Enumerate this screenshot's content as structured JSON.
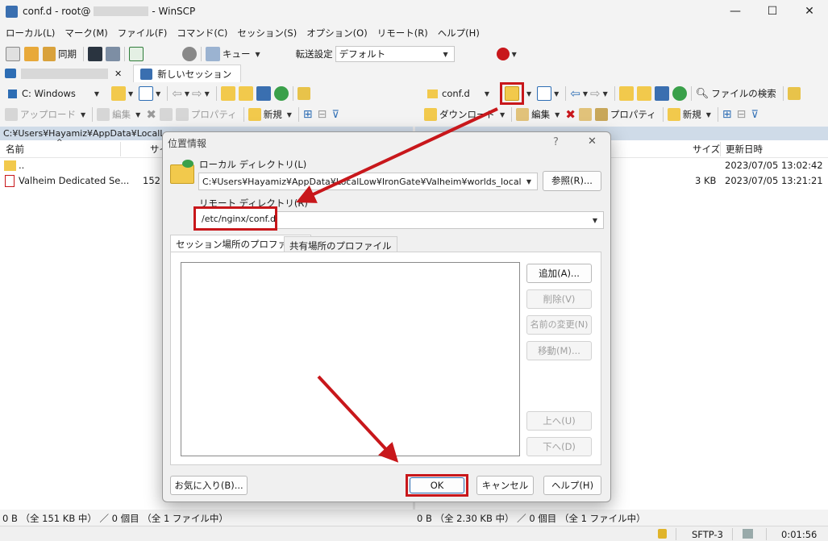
{
  "window": {
    "title_prefix": "conf.d - root@",
    "title_suffix": "- WinSCP",
    "minimize": "—",
    "maximize": "☐",
    "close": "✕"
  },
  "menu": [
    "ローカル(L)",
    "マーク(M)",
    "ファイル(F)",
    "コマンド(C)",
    "セッション(S)",
    "オプション(O)",
    "リモート(R)",
    "ヘルプ(H)"
  ],
  "toolbar": {
    "sync": "同期",
    "queue": "キュー",
    "transfer_label": "転送設定",
    "transfer_value": "デフォルト"
  },
  "tabs": {
    "new_session": "新しいセッション"
  },
  "local": {
    "drive": "C: Windows",
    "upload": "アップロード",
    "edit": "編集",
    "properties": "プロパティ",
    "new": "新規",
    "path": "C:¥Users¥Hayamiz¥AppData¥LocalLow",
    "col_name": "名前",
    "col_size": "サイ",
    "rows": [
      {
        "name": "..",
        "size": ""
      },
      {
        "name": "Valheim Dedicated Se...",
        "size": "152 K"
      }
    ],
    "status": "0 B （全 151 KB 中） ／ 0 個目 （全 1 ファイル中）"
  },
  "remote": {
    "folder": "conf.d",
    "find_files": "ファイルの検索",
    "download": "ダウンロード",
    "edit": "編集",
    "properties": "プロパティ",
    "new": "新規",
    "col_size": "サイズ",
    "col_modified": "更新日時",
    "rows": [
      {
        "size": "",
        "modified": "2023/07/05 13:02:42"
      },
      {
        "size": "3 KB",
        "modified": "2023/07/05 13:21:21"
      }
    ],
    "status": "0 B （全 2.30 KB 中） ／ 0 個目 （全 1 ファイル中）"
  },
  "bottom": {
    "protocol": "SFTP-3",
    "time": "0:01:56"
  },
  "dialog": {
    "title": "位置情報",
    "help_icon": "?",
    "close_icon": "✕",
    "local_label": "ローカル ディレクトリ(L)",
    "local_value": "C:¥Users¥Hayamiz¥AppData¥LocalLow¥IronGate¥Valheim¥worlds_local",
    "browse": "参照(R)...",
    "remote_label": "リモート ディレクトリ(R)",
    "remote_value": "/etc/nginx/conf.d",
    "tab_session": "セッション場所のプロファイル",
    "tab_shared": "共有場所のプロファイル",
    "add": "追加(A)...",
    "delete": "削除(V)",
    "rename": "名前の変更(N)",
    "move": "移動(M)...",
    "up": "上へ(U)",
    "down": "下へ(D)",
    "favorites": "お気に入り(B)...",
    "ok": "OK",
    "cancel": "キャンセル",
    "help": "ヘルプ(H)"
  },
  "colors": {
    "accent_red": "#c8171b",
    "path_bar": "#cfdbe8"
  }
}
